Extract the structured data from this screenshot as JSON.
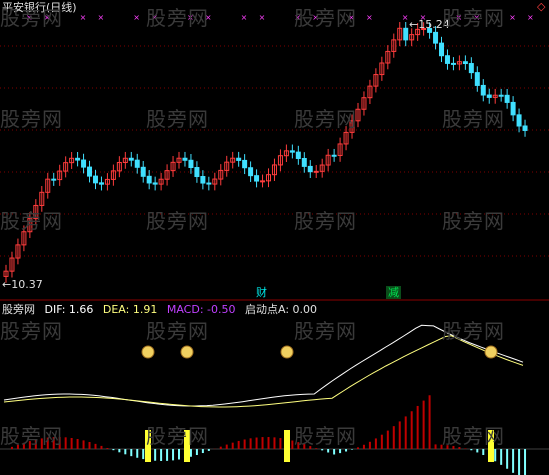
{
  "title": "平安银行(日线)",
  "high_label": "15.24",
  "low_label": "10.37",
  "signal_tags": [
    {
      "text": "财",
      "color": "#00e5e5"
    },
    {
      "text": "减",
      "color": "#00e050"
    }
  ],
  "indicator": {
    "name": "股旁网",
    "dif_label": "DIF: 1.66",
    "dea_label": "DEA: 1.91",
    "macd_label": "MACD: -0.50",
    "start_label": "启动点A: 0.00"
  },
  "watermark": "股旁网",
  "diamond_icon": "diamond-icon",
  "moneybag_icon": "money-bag-icon",
  "colors": {
    "up": "#ff3c3c",
    "down": "#40e0ff",
    "dif": "#ffffff",
    "dea": "#ffff80",
    "bar_pos": "#c00000",
    "bar_neg": "#80ffff",
    "marker": "#ff40ff",
    "signal": "#ffff33",
    "grid": "#800000"
  }
}
